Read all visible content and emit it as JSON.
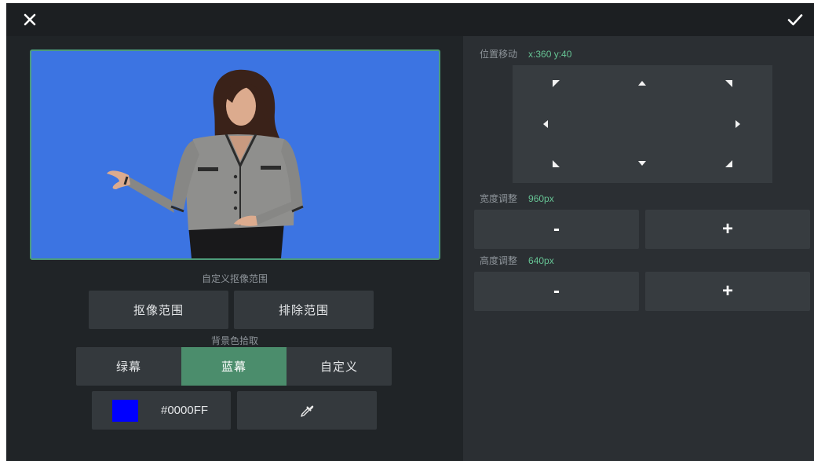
{
  "header": {
    "close_icon": "close-icon",
    "confirm_icon": "check-icon"
  },
  "preview": {
    "background_color": "#3c74e2",
    "border_color": "#4d9c7a"
  },
  "matting": {
    "section_label": "自定义抠像范围",
    "include_label": "抠像范围",
    "exclude_label": "排除范围"
  },
  "background": {
    "section_label": "背景色拾取",
    "options": [
      {
        "label": "绿幕",
        "selected": false
      },
      {
        "label": "蓝幕",
        "selected": true
      },
      {
        "label": "自定义",
        "selected": false
      }
    ],
    "color_value": "#0000FF",
    "swatch_color": "#0000FF",
    "picker_icon": "eyedropper-icon"
  },
  "position": {
    "label": "位置移动",
    "value": "x:360 y:40",
    "arrow_icons": [
      "arrow-up-left-icon",
      "arrow-up-icon",
      "arrow-up-right-icon",
      "arrow-left-icon",
      "arrow-right-icon",
      "arrow-down-left-icon",
      "arrow-down-icon",
      "arrow-down-right-icon"
    ]
  },
  "width": {
    "label": "宽度调整",
    "value": "960px",
    "decrease_label": "-",
    "increase_label": "+"
  },
  "height": {
    "label": "高度调整",
    "value": "640px",
    "decrease_label": "-",
    "increase_label": "+"
  },
  "colors": {
    "accent": "#4b8d6c",
    "value_text": "#66c394",
    "top_bar": "#1c1f22",
    "left_panel": "#202427",
    "right_panel": "#2b2f33",
    "button": "#34393d"
  }
}
